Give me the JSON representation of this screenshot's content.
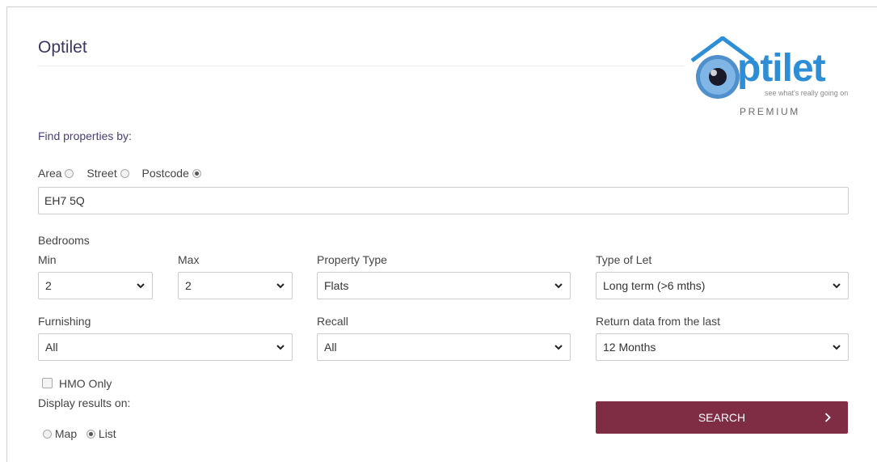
{
  "header": {
    "title": "Optilet"
  },
  "logo": {
    "text": "ptilet",
    "tagline": "see what's really going on",
    "premium": "PREMIUM"
  },
  "search_by": {
    "heading": "Find properties by:",
    "options": [
      {
        "label": "Area",
        "checked": false
      },
      {
        "label": "Street",
        "checked": false
      },
      {
        "label": "Postcode",
        "checked": true
      }
    ],
    "value": "EH7 5Q"
  },
  "filters": {
    "bedrooms_label": "Bedrooms",
    "min": {
      "label": "Min",
      "value": "2"
    },
    "max": {
      "label": "Max",
      "value": "2"
    },
    "property_type": {
      "label": "Property Type",
      "value": "Flats"
    },
    "type_of_let": {
      "label": "Type of Let",
      "value": "Long term (>6 mths)"
    },
    "furnishing": {
      "label": "Furnishing",
      "value": "All"
    },
    "recall": {
      "label": "Recall",
      "value": "All"
    },
    "return_data": {
      "label": "Return data from the last",
      "value": "12 Months"
    }
  },
  "hmo": {
    "label": "HMO Only",
    "checked": false
  },
  "display": {
    "label": "Display results on:",
    "options": [
      {
        "label": "Map",
        "checked": false
      },
      {
        "label": "List",
        "checked": true
      }
    ]
  },
  "search_button": {
    "label": "SEARCH"
  },
  "colors": {
    "brand": "#7e2d44",
    "title": "#3b3560",
    "logo_blue": "#2d8ed6"
  }
}
